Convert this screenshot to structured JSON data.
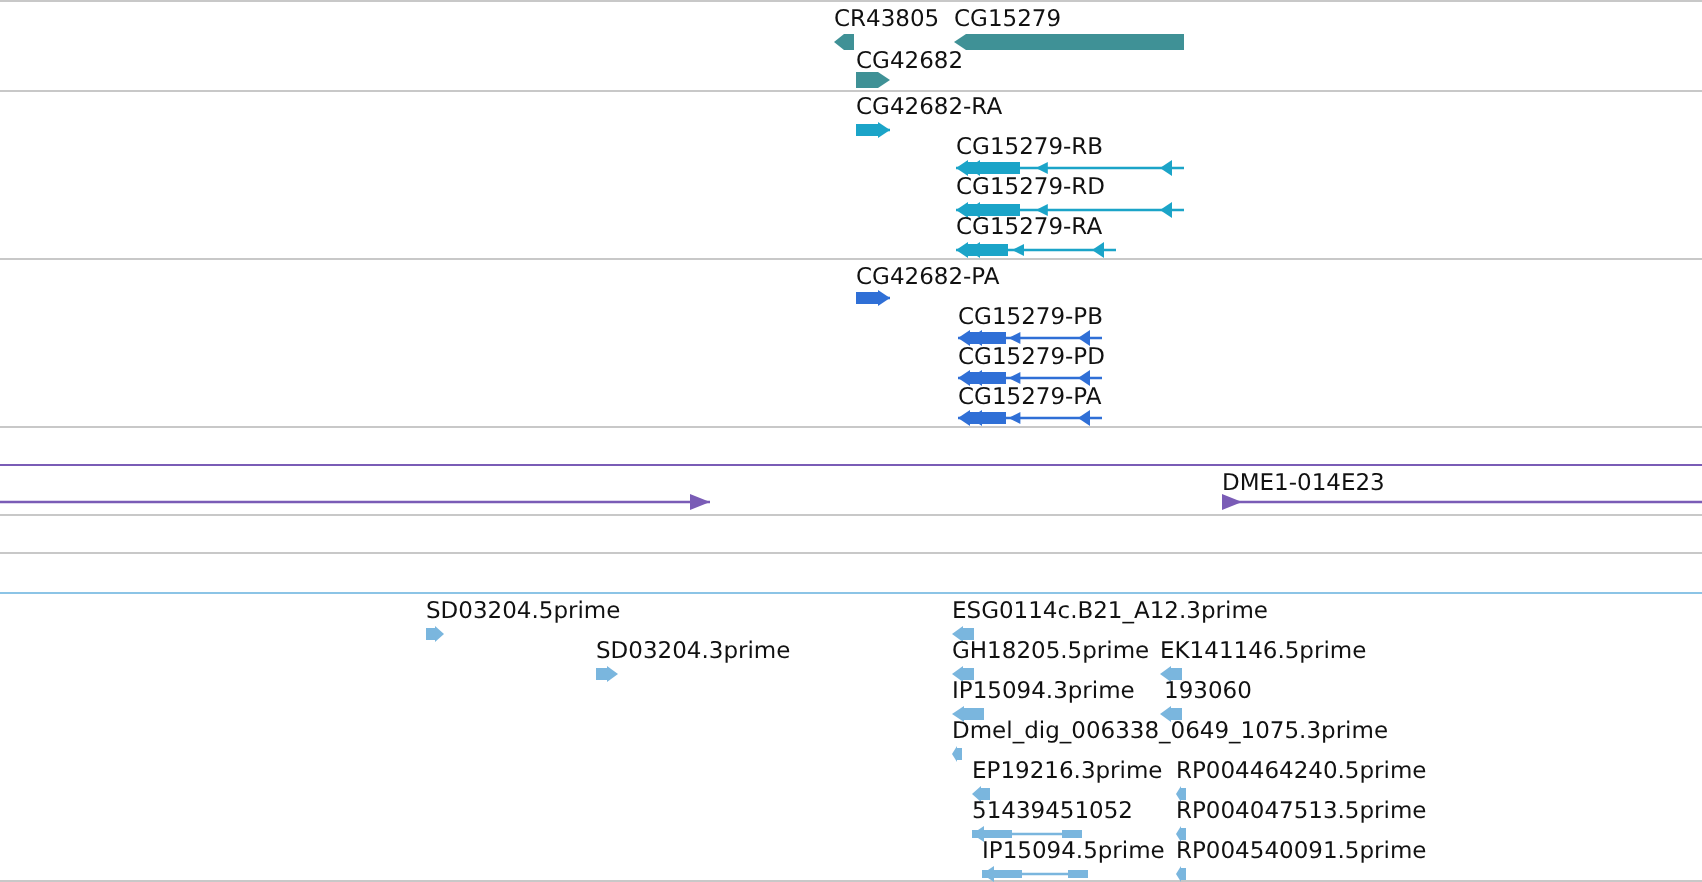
{
  "tracks": [
    {
      "kind": "gene",
      "color": "#3f9196",
      "features": [
        {
          "label": "CR43805",
          "reverse": true
        },
        {
          "label": "CG15279",
          "reverse": true
        },
        {
          "label": "CG42682",
          "reverse": false
        }
      ]
    },
    {
      "kind": "transcript",
      "color": "#1ba4c8",
      "features": [
        {
          "label": "CG42682-RA",
          "reverse": false
        },
        {
          "label": "CG15279-RB",
          "reverse": true
        },
        {
          "label": "CG15279-RD",
          "reverse": true
        },
        {
          "label": "CG15279-RA",
          "reverse": true
        }
      ]
    },
    {
      "kind": "transcript",
      "color": "#2f6fd6",
      "features": [
        {
          "label": "CG42682-PA",
          "reverse": false
        },
        {
          "label": "CG15279-PB",
          "reverse": true
        },
        {
          "label": "CG15279-PD",
          "reverse": true
        },
        {
          "label": "CG15279-PA",
          "reverse": true
        }
      ]
    },
    {
      "kind": "clone",
      "color": "#7a5cb6",
      "features": [
        {
          "reverse": false
        },
        {
          "label": "DME1-014E23",
          "reverse": false
        }
      ]
    },
    {
      "kind": "est",
      "color": "#7ab6de",
      "features": [
        {
          "label": "SD03204.5prime",
          "reverse": false
        },
        {
          "label": "SD03204.3prime",
          "reverse": false
        },
        {
          "label": "ESG0114c.B21_A12.3prime",
          "reverse": true
        },
        {
          "label": "GH18205.5prime",
          "reverse": true
        },
        {
          "label": "EK141146.5prime",
          "reverse": true
        },
        {
          "label": "IP15094.3prime",
          "reverse": true
        },
        {
          "label": "193060",
          "reverse": true
        },
        {
          "label": "Dmel_dig_006338_0649_1075.3prime",
          "reverse": true
        },
        {
          "label": "EP19216.3prime",
          "reverse": true
        },
        {
          "label": "RP004464240.5prime",
          "reverse": true
        },
        {
          "label": "51439451052",
          "reverse": true
        },
        {
          "label": "RP004047513.5prime",
          "reverse": true
        },
        {
          "label": "IP15094.5prime",
          "reverse": true
        },
        {
          "label": "RP004540091.5prime",
          "reverse": true
        }
      ]
    }
  ]
}
